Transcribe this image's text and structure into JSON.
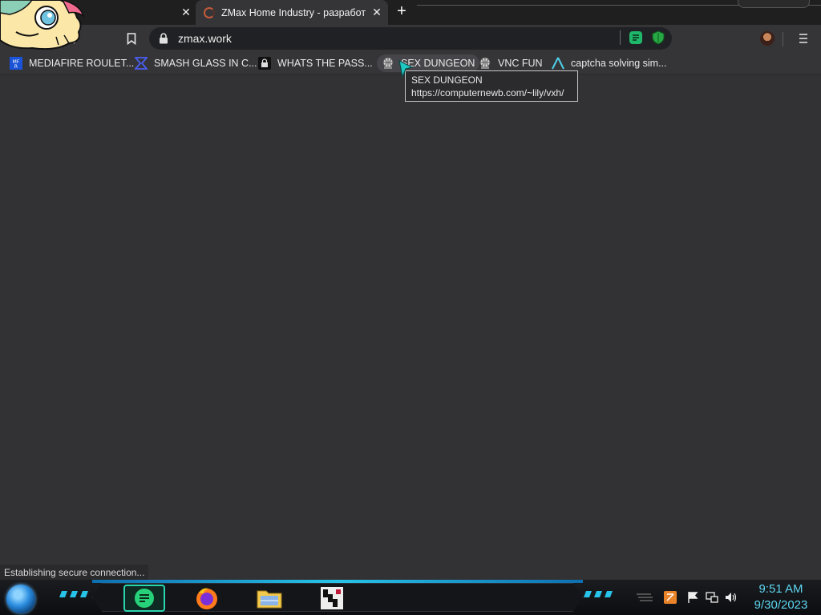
{
  "browser": {
    "tabs": [
      {
        "title": "",
        "active": false
      },
      {
        "title": "ZMax Home Industry - разработка",
        "active": true
      }
    ],
    "new_tab_symbol": "+",
    "close_symbol": "✕",
    "address_bar": {
      "url": "zmax.work"
    },
    "bookmarks": [
      {
        "label": "MEDIAFIRE ROULET...",
        "icon": "mediafire-icon"
      },
      {
        "label": "SMASH GLASS IN C...",
        "icon": "shatter-icon"
      },
      {
        "label": "WHATS THE PASS...",
        "icon": "lock-box-icon"
      },
      {
        "label": "SEX DUNGEON",
        "icon": "globe-server-icon"
      },
      {
        "label": "VNC FUN",
        "icon": "globe-server-icon"
      },
      {
        "label": "captcha solving sim...",
        "icon": "triangle-logo-icon"
      }
    ],
    "tooltip": {
      "title": "SEX DUNGEON",
      "url": "https://computernewb.com/~lily/vxh/"
    },
    "status_text": "Establishing secure connection..."
  },
  "taskbar": {
    "apps": [
      "chat-app-icon",
      "firefox-icon",
      "file-explorer-icon",
      "pixel-app-icon"
    ],
    "clock": {
      "time": "9:51 AM",
      "date": "9/30/2023"
    },
    "accent_color": "#27c3e8"
  },
  "colors": {
    "page_background": "#323234",
    "toolbar": "#353538",
    "tabstrip": "#1f1f20"
  }
}
